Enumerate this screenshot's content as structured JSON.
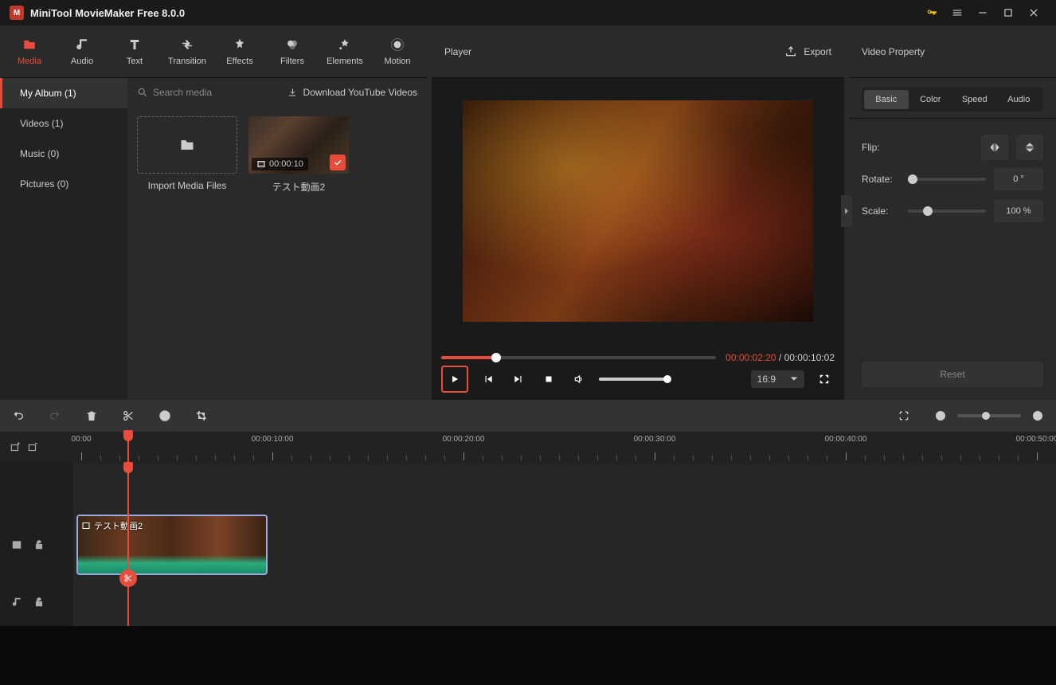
{
  "app": {
    "title": "MiniTool MovieMaker Free 8.0.0"
  },
  "tabs": {
    "media": "Media",
    "audio": "Audio",
    "text": "Text",
    "transition": "Transition",
    "effects": "Effects",
    "filters": "Filters",
    "elements": "Elements",
    "motion": "Motion"
  },
  "sidebar": {
    "album": "My Album (1)",
    "videos": "Videos (1)",
    "music": "Music (0)",
    "pictures": "Pictures (0)"
  },
  "media": {
    "search_placeholder": "Search media",
    "download": "Download YouTube Videos",
    "import": "Import Media Files",
    "clip_name": "テスト動画2",
    "clip_dur": "00:00:10"
  },
  "player": {
    "title": "Player",
    "export": "Export",
    "current": "00:00:02:20",
    "sep": " / ",
    "total": "00:00:10:02",
    "aspect": "16:9"
  },
  "props": {
    "title": "Video Property",
    "tab_basic": "Basic",
    "tab_color": "Color",
    "tab_speed": "Speed",
    "tab_audio": "Audio",
    "flip": "Flip:",
    "rotate": "Rotate:",
    "rotate_val": "0 °",
    "scale": "Scale:",
    "scale_val": "100 %",
    "reset": "Reset"
  },
  "ruler": {
    "t0": "00:00",
    "t1": "00:00:10:00",
    "t2": "00:00:20:00",
    "t3": "00:00:30:00",
    "t4": "00:00:40:00",
    "t5": "00:00:50:00"
  },
  "clip": {
    "name": "テスト動画2"
  }
}
